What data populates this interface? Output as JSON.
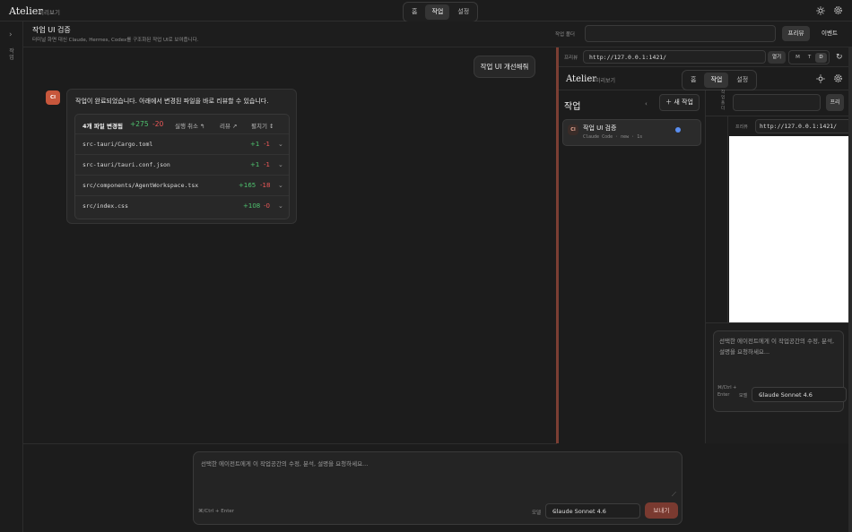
{
  "app": {
    "brand": "Atelier",
    "brand_sub": "미리보기"
  },
  "nav": {
    "tabs": [
      "홈",
      "작업",
      "설정"
    ],
    "active": "작업"
  },
  "rail": {
    "label": "작업"
  },
  "header": {
    "title": "작업 UI 검증",
    "subtitle": "터미널 화면 대신 Claude, Hermes, Codex를 구조화된 작업 UI로 보여줍니다.",
    "folder_label": "작업 폴더",
    "folder_value": "",
    "preview_button": "프리뷰",
    "events_button": "이벤트"
  },
  "chat": {
    "user_message": "작업 UI 개선해줘",
    "agent_avatar": "Cl",
    "agent_message": "작업이 완료되었습니다. 아래에서 변경된 파일을 바로 리뷰할 수 있습니다.",
    "changes": {
      "title": "4개 파일 변경됨",
      "added": "+275",
      "removed": "-20",
      "undo": "실행 취소 ↰",
      "review": "리뷰 ↗",
      "expand": "펼치기 ↕",
      "files": [
        {
          "name": "src-tauri/Cargo.toml",
          "added": "+1",
          "removed": "-1"
        },
        {
          "name": "src-tauri/tauri.conf.json",
          "added": "+1",
          "removed": "-1"
        },
        {
          "name": "src/components/AgentWorkspace.tsx",
          "added": "+165",
          "removed": "-18"
        },
        {
          "name": "src/index.css",
          "added": "+108",
          "removed": "-0"
        }
      ]
    }
  },
  "composer": {
    "placeholder": "선택한 에이전트에게 이 작업공간의 수정, 분석, 설명을 요청하세요...",
    "hint": "⌘/Ctrl + Enter",
    "model_label": "모델",
    "model_value": "Claude Sonnet 4.6",
    "send": "보내기"
  },
  "preview": {
    "label": "프리뷰",
    "url": "http://127.0.0.1:1421/",
    "open_button": "열기",
    "modes": [
      "M",
      "T",
      "D"
    ],
    "active_mode": "D",
    "inner": {
      "brand": "Atelier",
      "brand_sub": "미리보기",
      "tabs": [
        "홈",
        "작업",
        "설정"
      ],
      "active_tab": "작업",
      "section_title": "작업",
      "new_task": "새 작업",
      "task_title": "작업 UI 검증",
      "task_avatar": "Cl",
      "task_meta": "Claude Code · new · 1s",
      "folder_label": "작업 폴더",
      "preview_btn": "프리",
      "nested_label": "프리뷰",
      "nested_url": "http://127.0.0.1:1421/",
      "composer_placeholder": "선택한 에이전트에게 이 작업공간의 수정, 분석, 설명을 요청하세요...",
      "hint": "⌘/Ctrl + Enter",
      "model_label": "모델",
      "model_value": "Claude Sonnet 4.6"
    }
  },
  "colors": {
    "accent": "#c7573c",
    "added": "#4fc46f",
    "removed": "#ef5959",
    "divider": "#7b3e33"
  }
}
